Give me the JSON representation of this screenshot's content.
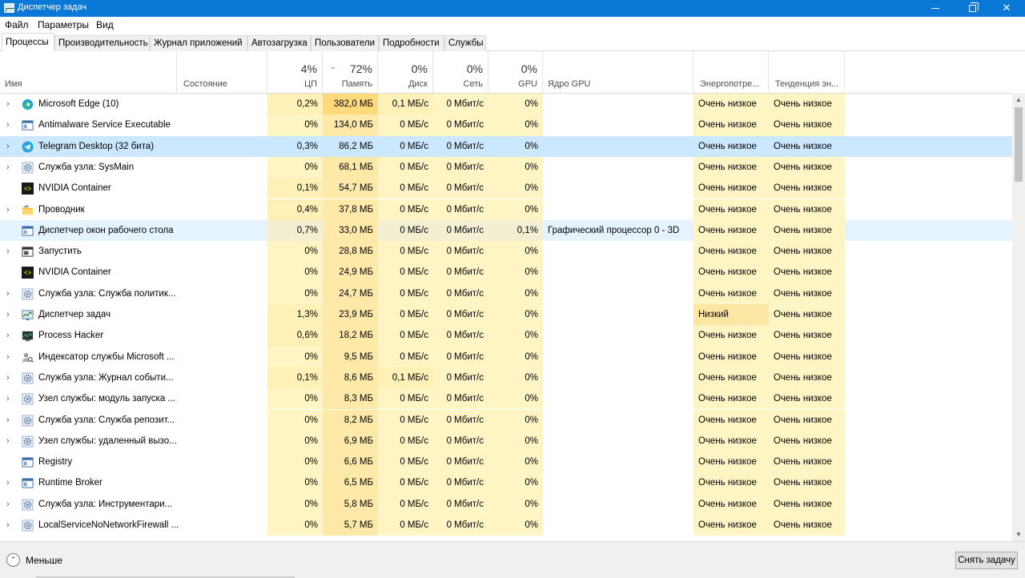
{
  "window": {
    "title": "Диспетчер задач",
    "min_glyph": "",
    "max_glyph": "",
    "close_glyph": "✕"
  },
  "menu": [
    "Файл",
    "Параметры",
    "Вид"
  ],
  "tabs": [
    "Процессы",
    "Производительность",
    "Журнал приложений",
    "Автозагрузка",
    "Пользователи",
    "Подробности",
    "Службы"
  ],
  "header": {
    "name": "Имя",
    "status": "Состояние",
    "cpu_pct": "4%",
    "cpu": "ЦП",
    "mem_pct": "72%",
    "mem": "Память",
    "disk_pct": "0%",
    "disk": "Диск",
    "net_pct": "0%",
    "net": "Сеть",
    "gpu_pct": "0%",
    "gpu": "GPU",
    "gpu_engine": "Ядро GPU",
    "power": "Энергопотре...",
    "power_trend": "Тенденция эн...",
    "sort_arrow": "⌄"
  },
  "colors": {
    "titlebar": "#0a78d7",
    "heat_light": "#fff4c4",
    "heat_mem": "#ffe9a8",
    "heat_mem_high": "#ffd97a",
    "selected_row": "#cce8ff",
    "hover_row": "#e5f3ff"
  },
  "processes": [
    {
      "name": "Microsoft Edge (10)",
      "icon": "edge-icon",
      "expand": "›",
      "cpu": "0,2%",
      "mem": "382,0 МБ",
      "disk": "0,1 МБ/с",
      "net": "0 Мбит/с",
      "gpu": "0%",
      "engine": "",
      "power": "Очень низкое",
      "trend": "Очень низкое"
    },
    {
      "name": "Antimalware Service Executable",
      "icon": "window-icon",
      "expand": "›",
      "cpu": "0%",
      "mem": "134,0 МБ",
      "disk": "0 МБ/с",
      "net": "0 Мбит/с",
      "gpu": "0%",
      "engine": "",
      "power": "Очень низкое",
      "trend": "Очень низкое"
    },
    {
      "name": "Telegram Desktop (32 бита)",
      "icon": "telegram-icon",
      "expand": "›",
      "cpu": "0,3%",
      "mem": "86,2 МБ",
      "disk": "0 МБ/с",
      "net": "0 Мбит/с",
      "gpu": "0%",
      "engine": "",
      "power": "Очень низкое",
      "trend": "Очень низкое",
      "state": "selected"
    },
    {
      "name": "Служба узла: SysMain",
      "icon": "gear-icon",
      "expand": "›",
      "cpu": "0%",
      "mem": "68,1 МБ",
      "disk": "0 МБ/с",
      "net": "0 Мбит/с",
      "gpu": "0%",
      "engine": "",
      "power": "Очень низкое",
      "trend": "Очень низкое"
    },
    {
      "name": "NVIDIA Container",
      "icon": "nvidia-icon",
      "expand": "",
      "cpu": "0,1%",
      "mem": "54,7 МБ",
      "disk": "0 МБ/с",
      "net": "0 Мбит/с",
      "gpu": "0%",
      "engine": "",
      "power": "Очень низкое",
      "trend": "Очень низкое"
    },
    {
      "name": "Проводник",
      "icon": "folder-icon",
      "expand": "›",
      "cpu": "0,4%",
      "mem": "37,8 МБ",
      "disk": "0 МБ/с",
      "net": "0 Мбит/с",
      "gpu": "0%",
      "engine": "",
      "power": "Очень низкое",
      "trend": "Очень низкое"
    },
    {
      "name": "Диспетчер окон рабочего стола",
      "icon": "window-icon",
      "expand": "",
      "cpu": "0,7%",
      "mem": "33,0 МБ",
      "disk": "0 МБ/с",
      "net": "0 Мбит/с",
      "gpu": "0,1%",
      "engine": "Графический процессор 0 - 3D",
      "power": "Очень низкое",
      "trend": "Очень низкое",
      "state": "hover"
    },
    {
      "name": "Запустить",
      "icon": "run-icon",
      "expand": "›",
      "cpu": "0%",
      "mem": "28,8 МБ",
      "disk": "0 МБ/с",
      "net": "0 Мбит/с",
      "gpu": "0%",
      "engine": "",
      "power": "Очень низкое",
      "trend": "Очень низкое"
    },
    {
      "name": "NVIDIA Container",
      "icon": "nvidia-icon",
      "expand": "",
      "cpu": "0%",
      "mem": "24,9 МБ",
      "disk": "0 МБ/с",
      "net": "0 Мбит/с",
      "gpu": "0%",
      "engine": "",
      "power": "Очень низкое",
      "trend": "Очень низкое"
    },
    {
      "name": "Служба узла: Служба политик...",
      "icon": "gear-icon",
      "expand": "›",
      "cpu": "0%",
      "mem": "24,7 МБ",
      "disk": "0 МБ/с",
      "net": "0 Мбит/с",
      "gpu": "0%",
      "engine": "",
      "power": "Очень низкое",
      "trend": "Очень низкое"
    },
    {
      "name": "Диспетчер задач",
      "icon": "task-manager-icon",
      "expand": "›",
      "cpu": "1,3%",
      "mem": "23,9 МБ",
      "disk": "0 МБ/с",
      "net": "0 Мбит/с",
      "gpu": "0%",
      "engine": "",
      "power": "Низкий",
      "trend": "Очень низкое",
      "power_level": "low"
    },
    {
      "name": "Process Hacker",
      "icon": "process-hacker-icon",
      "expand": "›",
      "cpu": "0,6%",
      "mem": "18,2 МБ",
      "disk": "0 МБ/с",
      "net": "0 Мбит/с",
      "gpu": "0%",
      "engine": "",
      "power": "Очень низкое",
      "trend": "Очень низкое"
    },
    {
      "name": "Индексатор службы Microsoft ...",
      "icon": "user-search-icon",
      "expand": "›",
      "cpu": "0%",
      "mem": "9,5 МБ",
      "disk": "0 МБ/с",
      "net": "0 Мбит/с",
      "gpu": "0%",
      "engine": "",
      "power": "Очень низкое",
      "trend": "Очень низкое"
    },
    {
      "name": "Служба узла: Журнал событи...",
      "icon": "gear-icon",
      "expand": "›",
      "cpu": "0,1%",
      "mem": "8,6 МБ",
      "disk": "0,1 МБ/с",
      "net": "0 Мбит/с",
      "gpu": "0%",
      "engine": "",
      "power": "Очень низкое",
      "trend": "Очень низкое"
    },
    {
      "name": "Узел службы: модуль запуска ...",
      "icon": "gear-icon",
      "expand": "›",
      "cpu": "0%",
      "mem": "8,3 МБ",
      "disk": "0 МБ/с",
      "net": "0 Мбит/с",
      "gpu": "0%",
      "engine": "",
      "power": "Очень низкое",
      "trend": "Очень низкое"
    },
    {
      "name": "Служба узла: Служба репозит...",
      "icon": "gear-icon",
      "expand": "›",
      "cpu": "0%",
      "mem": "8,2 МБ",
      "disk": "0 МБ/с",
      "net": "0 Мбит/с",
      "gpu": "0%",
      "engine": "",
      "power": "Очень низкое",
      "trend": "Очень низкое"
    },
    {
      "name": "Узел службы: удаленный вызо...",
      "icon": "gear-icon",
      "expand": "›",
      "cpu": "0%",
      "mem": "6,9 МБ",
      "disk": "0 МБ/с",
      "net": "0 Мбит/с",
      "gpu": "0%",
      "engine": "",
      "power": "Очень низкое",
      "trend": "Очень низкое"
    },
    {
      "name": "Registry",
      "icon": "window-icon",
      "expand": "",
      "cpu": "0%",
      "mem": "6,6 МБ",
      "disk": "0 МБ/с",
      "net": "0 Мбит/с",
      "gpu": "0%",
      "engine": "",
      "power": "Очень низкое",
      "trend": "Очень низкое"
    },
    {
      "name": "Runtime Broker",
      "icon": "window-icon",
      "expand": "›",
      "cpu": "0%",
      "mem": "6,5 МБ",
      "disk": "0 МБ/с",
      "net": "0 Мбит/с",
      "gpu": "0%",
      "engine": "",
      "power": "Очень низкое",
      "trend": "Очень низкое"
    },
    {
      "name": "Служба узла: Инструментари...",
      "icon": "gear-icon",
      "expand": "›",
      "cpu": "0%",
      "mem": "5,8 МБ",
      "disk": "0 МБ/с",
      "net": "0 Мбит/с",
      "gpu": "0%",
      "engine": "",
      "power": "Очень низкое",
      "trend": "Очень низкое"
    },
    {
      "name": "LocalServiceNoNetworkFirewall ...",
      "icon": "gear-icon",
      "expand": "›",
      "cpu": "0%",
      "mem": "5,7 МБ",
      "disk": "0 МБ/с",
      "net": "0 Мбит/с",
      "gpu": "0%",
      "engine": "",
      "power": "Очень низкое",
      "trend": "Очень низкое"
    }
  ],
  "footer": {
    "fewer_label": "Меньше",
    "fewer_glyph": "⌃",
    "end_task_label": "Снять задачу"
  },
  "scrollbar": {
    "up": "▲",
    "down": "▼"
  }
}
